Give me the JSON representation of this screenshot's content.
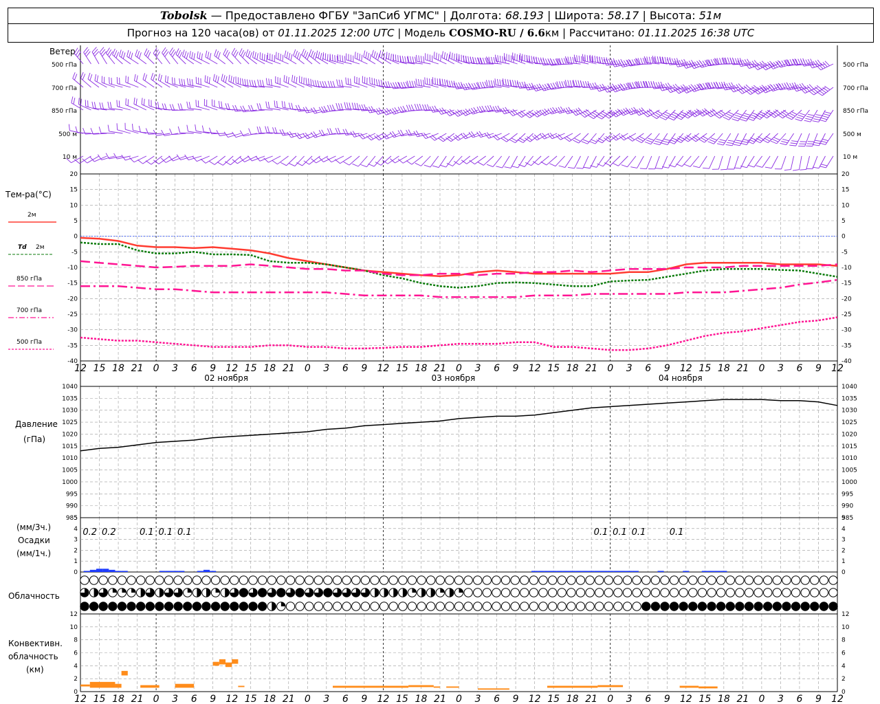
{
  "header": {
    "station": "Tobolsk",
    "provider": "— Предоставлено ФГБУ \"ЗапСиб УГМС\" |",
    "lon_label": "Долгота:",
    "lon": "68.193",
    "lat_label": "| Широта:",
    "lat": "58.17",
    "alt_label": "| Высота:",
    "alt": "51м",
    "forecast": "Прогноз на 120 часа(ов) от",
    "start": "01.11.2025 12:00 UTC",
    "model_label": "| Модель",
    "model": "COSMO-RU / 6.6",
    "model_unit": "км | Рассчитано:",
    "computed": "01.11.2025 16:38 UTC"
  },
  "labels": {
    "wind": "Ветер",
    "wind_levels": [
      "500 гПа",
      "700 гПа",
      "850 гПа",
      "500 м",
      "10  м"
    ],
    "temp": "Тем-ра(°С)",
    "t2m": "2м",
    "td": "Td",
    "td2m": "2м",
    "t850": "850 гПа",
    "t700": "700 гПа",
    "t500": "500 гПа",
    "pressure": "Давление",
    "pressure_unit": "(гПа)",
    "precip_unit3": "(мм/3ч.)",
    "precip": "Осадки",
    "precip_unit1": "(мм/1ч.)",
    "clouds": "Облачность",
    "conv1": "Конвективн.",
    "conv2": "облачность",
    "conv3": "(км)"
  },
  "colors": {
    "t2m": "#ff3b30",
    "td": "#0a7a0a",
    "upper": "#ff1493",
    "wind": "#8a2be2",
    "precip": "#1e3cff",
    "conv": "#ff8c1a",
    "zero_line": "#3355ff"
  },
  "chart_data": [
    {
      "type": "line",
      "title": "Тем-ра(°С)",
      "x_hours": [
        0,
        3,
        6,
        9,
        12,
        15,
        18,
        21,
        24,
        27,
        30,
        33,
        36,
        39,
        42,
        45,
        48,
        51,
        54,
        57,
        60,
        63,
        66,
        69,
        72,
        75,
        78,
        81,
        84,
        87,
        90,
        93,
        96,
        99,
        102,
        105,
        108,
        111,
        114,
        117,
        120
      ],
      "x_ticks": [
        "12",
        "15",
        "18",
        "21",
        "0",
        "3",
        "6",
        "9",
        "12",
        "15",
        "18",
        "21",
        "0",
        "3",
        "6",
        "9",
        "12",
        "15",
        "18",
        "21",
        "0",
        "3",
        "6",
        "9",
        "12",
        "15",
        "18",
        "21",
        "0",
        "3",
        "6",
        "9",
        "12",
        "15",
        "18",
        "21",
        "0",
        "3",
        "6",
        "9",
        "12",
        "15",
        "18"
      ],
      "date_labels": [
        "02 ноября",
        "03 ноября",
        "04 ноября"
      ],
      "ylim": [
        -40,
        20
      ],
      "y_ticks": [
        20,
        15,
        10,
        5,
        0,
        -5,
        -10,
        -15,
        -20,
        -25,
        -30,
        -35,
        -40
      ],
      "series": [
        {
          "name": "2м",
          "values": [
            -0.5,
            -0.8,
            -1.5,
            -3,
            -3.5,
            -3.5,
            -3.8,
            -3.5,
            -4,
            -4.5,
            -5.5,
            -7,
            -8,
            -9,
            -10,
            -11,
            -11.5,
            -12,
            -12.5,
            -12.8,
            -12.5,
            -11.5,
            -11,
            -11.5,
            -12,
            -12,
            -12,
            -12,
            -12,
            -11.5,
            -11.5,
            -10.5,
            -9,
            -8.5,
            -8.5,
            -8.5,
            -8.5,
            -9,
            -9,
            -9,
            -9.5
          ]
        },
        {
          "name": "Td 2м",
          "values": [
            -2,
            -2.5,
            -2.5,
            -4.5,
            -5.5,
            -5.5,
            -5,
            -5.8,
            -5.8,
            -6,
            -8,
            -8.5,
            -8.5,
            -9,
            -10,
            -11,
            -12.5,
            -13.5,
            -15,
            -16,
            -16.5,
            -16,
            -15,
            -14.8,
            -15,
            -15.5,
            -16,
            -16,
            -14.5,
            -14.2,
            -14,
            -13,
            -12,
            -11,
            -10.5,
            -10.5,
            -10.5,
            -10.8,
            -11,
            -12,
            -13
          ]
        },
        {
          "name": "850 гПа",
          "values": [
            -8,
            -8.5,
            -9,
            -9.5,
            -10,
            -9.8,
            -9.5,
            -9.5,
            -9.5,
            -9,
            -9.5,
            -10,
            -10.5,
            -10.5,
            -11,
            -11,
            -12,
            -12.5,
            -12.5,
            -12,
            -12,
            -12.5,
            -12,
            -12,
            -11.5,
            -11.5,
            -11,
            -11.5,
            -11,
            -10.5,
            -10.5,
            -10.5,
            -10,
            -10,
            -10,
            -9.5,
            -9.5,
            -9.5,
            -9.5,
            -9.5,
            -9
          ]
        },
        {
          "name": "700 гПа",
          "values": [
            -16,
            -16,
            -16,
            -16.5,
            -17,
            -17,
            -17.5,
            -18,
            -18,
            -18,
            -18,
            -18,
            -18,
            -18,
            -18.5,
            -19,
            -19,
            -19,
            -19,
            -19.5,
            -19.5,
            -19.5,
            -19.5,
            -19.5,
            -19,
            -19,
            -19,
            -18.5,
            -18.5,
            -18.5,
            -18.5,
            -18.5,
            -18,
            -18,
            -18,
            -17.5,
            -17,
            -16.5,
            -15.5,
            -14.8,
            -14
          ]
        },
        {
          "name": "500 гПа",
          "values": [
            -32.5,
            -33,
            -33.5,
            -33.5,
            -34,
            -34.5,
            -35,
            -35.5,
            -35.5,
            -35.5,
            -35,
            -35,
            -35.5,
            -35.5,
            -36,
            -36,
            -35.8,
            -35.5,
            -35.5,
            -35,
            -34.5,
            -34.5,
            -34.5,
            -34,
            -34,
            -35.5,
            -35.5,
            -36,
            -36.5,
            -36.5,
            -36,
            -35,
            -33.5,
            -32,
            -31,
            -30.5,
            -29.5,
            -28.5,
            -27.5,
            -27,
            -26
          ]
        }
      ]
    },
    {
      "type": "line",
      "title": "Давление",
      "ylabel": "(гПа)",
      "x_hours": [
        0,
        3,
        6,
        9,
        12,
        15,
        18,
        21,
        24,
        27,
        30,
        33,
        36,
        39,
        42,
        45,
        48,
        51,
        54,
        57,
        60,
        63,
        66,
        69,
        72,
        75,
        78,
        81,
        84,
        87,
        90,
        93,
        96,
        99,
        102,
        105,
        108,
        111,
        114,
        117,
        120
      ],
      "ylim": [
        985,
        1040
      ],
      "y_ticks": [
        1040,
        1035,
        1030,
        1025,
        1020,
        1015,
        1010,
        1005,
        1000,
        995,
        990,
        985
      ],
      "series": [
        {
          "name": "Давление",
          "values": [
            1013,
            1014,
            1014.5,
            1015.5,
            1016.5,
            1017,
            1017.5,
            1018.5,
            1019,
            1019.5,
            1020,
            1020.5,
            1021,
            1022,
            1022.5,
            1023.5,
            1024,
            1024.5,
            1025,
            1025.5,
            1026.5,
            1027,
            1027.5,
            1027.5,
            1028,
            1029,
            1030,
            1031,
            1031.5,
            1032,
            1032.5,
            1033,
            1033.5,
            1034,
            1034.5,
            1034.5,
            1034.5,
            1034,
            1034,
            1033.5,
            1032
          ]
        }
      ]
    },
    {
      "type": "bar",
      "title": "Осадки",
      "ylabel": "(мм/3ч.) (мм/1ч.)",
      "ylim": [
        0,
        5
      ],
      "y_ticks": [
        5,
        4,
        3,
        2,
        1,
        0
      ],
      "x_hours": [
        1,
        2,
        3,
        4,
        5,
        6,
        7,
        13,
        14,
        15,
        16,
        19,
        20,
        21,
        72,
        73,
        74,
        75,
        76,
        77,
        78,
        79,
        80,
        81,
        82,
        83,
        84,
        85,
        86,
        87,
        88,
        92,
        96,
        99,
        100,
        101,
        102
      ],
      "values": [
        0.1,
        0.2,
        0.3,
        0.3,
        0.2,
        0.1,
        0.1,
        0.1,
        0.1,
        0.1,
        0.1,
        0.1,
        0.2,
        0.1,
        0.1,
        0.1,
        0.1,
        0.1,
        0.1,
        0.1,
        0.1,
        0.1,
        0.1,
        0.1,
        0.1,
        0.1,
        0.1,
        0.1,
        0.1,
        0.1,
        0.1,
        0.1,
        0.1,
        0.1,
        0.1,
        0.1,
        0.1
      ],
      "totals_3h": [
        {
          "hour": 1.5,
          "text": "0.2"
        },
        {
          "hour": 4.5,
          "text": "0.2"
        },
        {
          "hour": 10.5,
          "text": "0.1"
        },
        {
          "hour": 13.5,
          "text": "0.1"
        },
        {
          "hour": 16.5,
          "text": "0.1"
        },
        {
          "hour": 82.5,
          "text": "0.1"
        },
        {
          "hour": 85.5,
          "text": "0.1"
        },
        {
          "hour": 88.5,
          "text": "0.1"
        },
        {
          "hour": 94.5,
          "text": "0.1"
        }
      ]
    },
    {
      "type": "heatmap",
      "title": "Облачность",
      "rows": 3,
      "cols": 81,
      "row_high": "00000000000000000000000000000000000000000000000000000000000000000000000000000000000000004432",
      "row_mid": "3231112323312212343434343343333222212212100000000000000000000000000000000000000000000000000",
      "row_low": "4444444444444444444421000000000000000000000000000000000000004444444444444444444444444000000"
    },
    {
      "type": "bar",
      "title": "Конвективн. облачность",
      "ylabel": "(км)",
      "ylim": [
        0,
        12
      ],
      "y_ticks": [
        12,
        10,
        8,
        6,
        4,
        2,
        0
      ],
      "segments": [
        {
          "h0": 0,
          "h1": 1.5,
          "bottom": 0.8,
          "top": 1.1
        },
        {
          "h0": 1.5,
          "h1": 5.5,
          "bottom": 0.6,
          "top": 1.5
        },
        {
          "h0": 5.5,
          "h1": 6.5,
          "bottom": 0.6,
          "top": 1.2
        },
        {
          "h0": 6.5,
          "h1": 7.5,
          "bottom": 2.5,
          "top": 3.2
        },
        {
          "h0": 9.5,
          "h1": 12.5,
          "bottom": 0.6,
          "top": 1.0
        },
        {
          "h0": 15,
          "h1": 18,
          "bottom": 0.6,
          "top": 1.2
        },
        {
          "h0": 21,
          "h1": 22,
          "bottom": 4.0,
          "top": 4.6
        },
        {
          "h0": 22,
          "h1": 23,
          "bottom": 4.2,
          "top": 5.0
        },
        {
          "h0": 23,
          "h1": 24,
          "bottom": 3.8,
          "top": 4.5
        },
        {
          "h0": 24,
          "h1": 25,
          "bottom": 4.3,
          "top": 5.0
        },
        {
          "h0": 25,
          "h1": 26,
          "bottom": 0.7,
          "top": 0.9
        },
        {
          "h0": 40,
          "h1": 52,
          "bottom": 0.6,
          "top": 0.9
        },
        {
          "h0": 52,
          "h1": 56,
          "bottom": 0.7,
          "top": 1.0
        },
        {
          "h0": 56,
          "h1": 57,
          "bottom": 0.6,
          "top": 0.8
        },
        {
          "h0": 58,
          "h1": 60,
          "bottom": 0.6,
          "top": 0.8
        },
        {
          "h0": 63,
          "h1": 68,
          "bottom": 0.3,
          "top": 0.5
        },
        {
          "h0": 74,
          "h1": 82,
          "bottom": 0.6,
          "top": 0.9
        },
        {
          "h0": 82,
          "h1": 86,
          "bottom": 0.7,
          "top": 1.0
        },
        {
          "h0": 95,
          "h1": 98,
          "bottom": 0.6,
          "top": 0.9
        },
        {
          "h0": 98,
          "h1": 101,
          "bottom": 0.5,
          "top": 0.8
        }
      ]
    },
    {
      "type": "scatter",
      "title": "Ветер",
      "levels": [
        "500 гПа",
        "700 гПа",
        "850 гПа",
        "500 м",
        "10  м"
      ],
      "x_hours_step": 1,
      "dir_start": [
        320,
        300,
        290,
        280,
        250
      ],
      "dir_end": [
        250,
        245,
        220,
        210,
        200
      ],
      "speed_start": [
        25,
        20,
        15,
        10,
        5
      ],
      "speed_end": [
        65,
        55,
        45,
        30,
        15
      ]
    }
  ]
}
